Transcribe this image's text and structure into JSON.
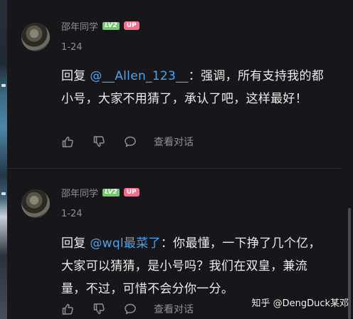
{
  "comments": [
    {
      "author": "邵年同学",
      "level_badge": "LV2",
      "up_badge": "UP",
      "date": "1-24",
      "reply_prefix": "回复 ",
      "mention": "@__Allen_123__",
      "text": "：强调，所有支持我的都小号，大家不用猜了，承认了吧，这样最好！",
      "view_dialog_label": "查看对话"
    },
    {
      "author": "邵年同学",
      "level_badge": "LV2",
      "up_badge": "UP",
      "date": "1-24",
      "reply_prefix": "回复 ",
      "mention": "@wql最菜了",
      "text": "：你最懂，一下挣了几个亿，大家可以猜猜，是小号吗？我们在双皇，兼流量，不过，可惜不会分你一分。",
      "view_dialog_label": "查看对话"
    }
  ],
  "watermark": "知乎 @DengDuck某邓",
  "icons": [
    "thumb-up-icon",
    "thumb-down-icon",
    "comment-bubble-icon"
  ],
  "colors": {
    "background": "#17171b",
    "mention": "#4ea3ea",
    "lv_badge": "#76c66e",
    "up_badge": "#f36e8c",
    "muted": "#8f8f96"
  }
}
